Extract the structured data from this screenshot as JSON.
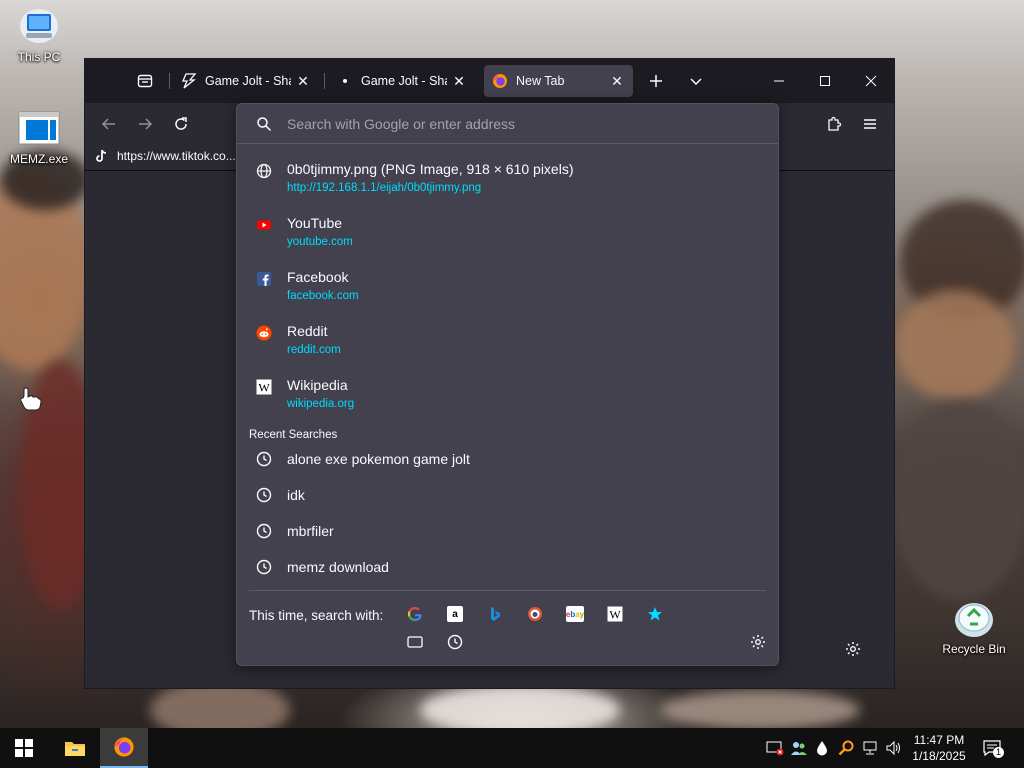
{
  "desktop": {
    "icons": [
      {
        "label": "This PC"
      },
      {
        "label": "MEMZ.exe"
      },
      {
        "label": "Recycle Bin"
      }
    ]
  },
  "browser": {
    "tabs": [
      {
        "title": "Game Jolt - Share y",
        "icon": "game-jolt-icon",
        "active": false
      },
      {
        "title": "Game Jolt - Share y",
        "icon": "dot-icon",
        "active": false
      },
      {
        "title": "New Tab",
        "icon": "firefox-icon",
        "active": true
      }
    ],
    "bookmarks": [
      {
        "label": "https://www.tiktok.co...",
        "icon": "tiktok-icon"
      }
    ],
    "urlbar": {
      "placeholder": "Search with Google or enter address",
      "value": "",
      "results": [
        {
          "title": "0b0tjimmy.png (PNG Image, 918 × 610 pixels)",
          "url": "http://192.168.1.1/eijah/0b0tjimmy.png",
          "icon": "globe-icon"
        },
        {
          "title": "YouTube",
          "url": "youtube.com",
          "icon": "youtube-icon"
        },
        {
          "title": "Facebook",
          "url": "facebook.com",
          "icon": "facebook-icon"
        },
        {
          "title": "Reddit",
          "url": "reddit.com",
          "icon": "reddit-icon"
        },
        {
          "title": "Wikipedia",
          "url": "wikipedia.org",
          "icon": "wikipedia-icon"
        }
      ],
      "recent_label": "Recent Searches",
      "recent": [
        {
          "text": "alone exe pokemon game jolt"
        },
        {
          "text": "idk"
        },
        {
          "text": "mbrfiler"
        },
        {
          "text": "memz download"
        }
      ],
      "oneoff_label": "This time, search with:",
      "engines": [
        "google-icon",
        "amazon-icon",
        "bing-icon",
        "duckduckgo-icon",
        "ebay-icon",
        "wikipedia-icon",
        "bookmarks-star-icon",
        "tabs-icon",
        "history-icon"
      ]
    }
  },
  "taskbar": {
    "time": "11:47 PM",
    "date": "1/18/2025",
    "notification_count": "1"
  },
  "colors": {
    "accent_link": "#00ddff",
    "panel": "#42414d",
    "toolbar": "#2b2a33",
    "tabbar": "#1c1b22"
  }
}
